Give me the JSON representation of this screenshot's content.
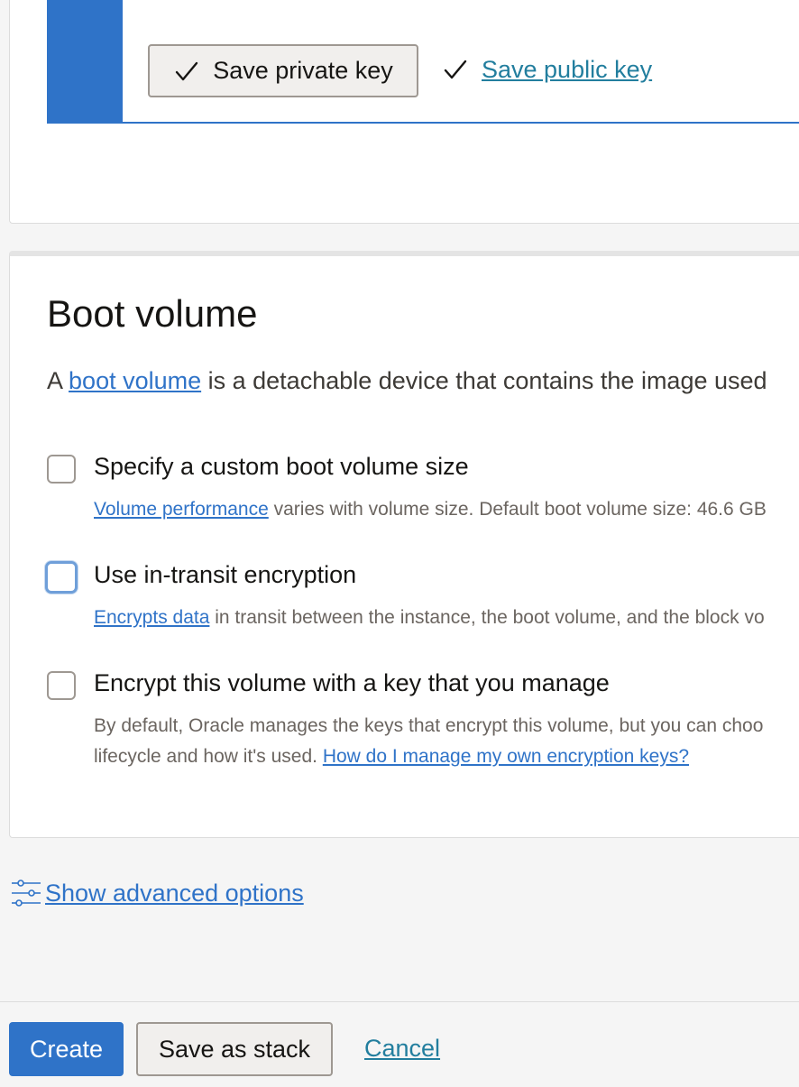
{
  "ssh_keys": {
    "save_private_key_label": "Save private key",
    "save_public_key_label": "Save public key"
  },
  "boot_volume": {
    "title": "Boot volume",
    "description_prefix": "A ",
    "description_link": "boot volume",
    "description_suffix": " is a detachable device that contains the image used",
    "options": [
      {
        "label": "Specify a custom boot volume size",
        "help_link": "Volume performance",
        "help_text": " varies with volume size. Default boot volume size: 46.6 GB",
        "checked": false
      },
      {
        "label": "Use in-transit encryption",
        "help_link": "Encrypts data",
        "help_text": " in transit between the instance, the boot volume, and the block vo",
        "checked": false,
        "focused": true
      },
      {
        "label": "Encrypt this volume with a key that you manage",
        "help_line1": "By default, Oracle manages the keys that encrypt this volume, but you can choo",
        "help_line2": "lifecycle and how it's used. ",
        "help_link": "How do I manage my own encryption keys?",
        "checked": false
      }
    ]
  },
  "advanced": {
    "label": "Show advanced options",
    "icon": "sliders-icon"
  },
  "footer": {
    "create_label": "Create",
    "save_stack_label": "Save as stack",
    "cancel_label": "Cancel"
  },
  "colors": {
    "accent": "#2f73c8",
    "link_teal": "#227e9e",
    "page_bg": "#f5f5f5",
    "card_border": "#dcdcdc"
  }
}
